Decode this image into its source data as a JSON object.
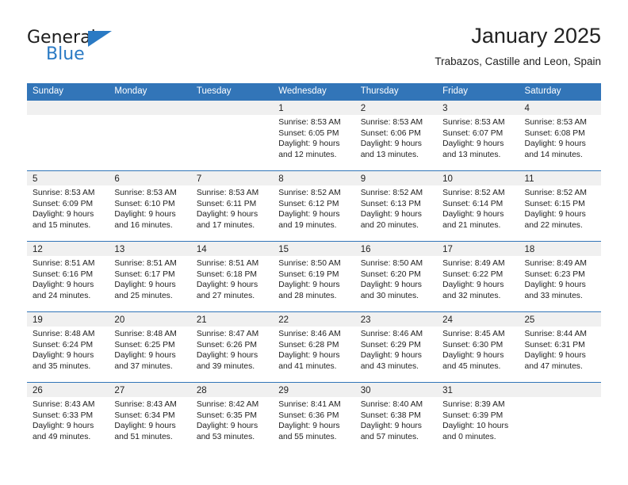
{
  "brand": {
    "name_part1": "General",
    "name_part2": "Blue",
    "triangle_icon": "triangle-icon",
    "accent_color": "#2a7ac4"
  },
  "header": {
    "title": "January 2025",
    "subtitle": "Trabazos, Castille and Leon, Spain"
  },
  "calendar": {
    "header_bg": "#3275b8",
    "daynum_bg": "#f0f0f0",
    "weekdays": [
      "Sunday",
      "Monday",
      "Tuesday",
      "Wednesday",
      "Thursday",
      "Friday",
      "Saturday"
    ],
    "weeks": [
      [
        {
          "day": "",
          "sunrise": "",
          "sunset": "",
          "daylight1": "",
          "daylight2": ""
        },
        {
          "day": "",
          "sunrise": "",
          "sunset": "",
          "daylight1": "",
          "daylight2": ""
        },
        {
          "day": "",
          "sunrise": "",
          "sunset": "",
          "daylight1": "",
          "daylight2": ""
        },
        {
          "day": "1",
          "sunrise": "Sunrise: 8:53 AM",
          "sunset": "Sunset: 6:05 PM",
          "daylight1": "Daylight: 9 hours",
          "daylight2": "and 12 minutes."
        },
        {
          "day": "2",
          "sunrise": "Sunrise: 8:53 AM",
          "sunset": "Sunset: 6:06 PM",
          "daylight1": "Daylight: 9 hours",
          "daylight2": "and 13 minutes."
        },
        {
          "day": "3",
          "sunrise": "Sunrise: 8:53 AM",
          "sunset": "Sunset: 6:07 PM",
          "daylight1": "Daylight: 9 hours",
          "daylight2": "and 13 minutes."
        },
        {
          "day": "4",
          "sunrise": "Sunrise: 8:53 AM",
          "sunset": "Sunset: 6:08 PM",
          "daylight1": "Daylight: 9 hours",
          "daylight2": "and 14 minutes."
        }
      ],
      [
        {
          "day": "5",
          "sunrise": "Sunrise: 8:53 AM",
          "sunset": "Sunset: 6:09 PM",
          "daylight1": "Daylight: 9 hours",
          "daylight2": "and 15 minutes."
        },
        {
          "day": "6",
          "sunrise": "Sunrise: 8:53 AM",
          "sunset": "Sunset: 6:10 PM",
          "daylight1": "Daylight: 9 hours",
          "daylight2": "and 16 minutes."
        },
        {
          "day": "7",
          "sunrise": "Sunrise: 8:53 AM",
          "sunset": "Sunset: 6:11 PM",
          "daylight1": "Daylight: 9 hours",
          "daylight2": "and 17 minutes."
        },
        {
          "day": "8",
          "sunrise": "Sunrise: 8:52 AM",
          "sunset": "Sunset: 6:12 PM",
          "daylight1": "Daylight: 9 hours",
          "daylight2": "and 19 minutes."
        },
        {
          "day": "9",
          "sunrise": "Sunrise: 8:52 AM",
          "sunset": "Sunset: 6:13 PM",
          "daylight1": "Daylight: 9 hours",
          "daylight2": "and 20 minutes."
        },
        {
          "day": "10",
          "sunrise": "Sunrise: 8:52 AM",
          "sunset": "Sunset: 6:14 PM",
          "daylight1": "Daylight: 9 hours",
          "daylight2": "and 21 minutes."
        },
        {
          "day": "11",
          "sunrise": "Sunrise: 8:52 AM",
          "sunset": "Sunset: 6:15 PM",
          "daylight1": "Daylight: 9 hours",
          "daylight2": "and 22 minutes."
        }
      ],
      [
        {
          "day": "12",
          "sunrise": "Sunrise: 8:51 AM",
          "sunset": "Sunset: 6:16 PM",
          "daylight1": "Daylight: 9 hours",
          "daylight2": "and 24 minutes."
        },
        {
          "day": "13",
          "sunrise": "Sunrise: 8:51 AM",
          "sunset": "Sunset: 6:17 PM",
          "daylight1": "Daylight: 9 hours",
          "daylight2": "and 25 minutes."
        },
        {
          "day": "14",
          "sunrise": "Sunrise: 8:51 AM",
          "sunset": "Sunset: 6:18 PM",
          "daylight1": "Daylight: 9 hours",
          "daylight2": "and 27 minutes."
        },
        {
          "day": "15",
          "sunrise": "Sunrise: 8:50 AM",
          "sunset": "Sunset: 6:19 PM",
          "daylight1": "Daylight: 9 hours",
          "daylight2": "and 28 minutes."
        },
        {
          "day": "16",
          "sunrise": "Sunrise: 8:50 AM",
          "sunset": "Sunset: 6:20 PM",
          "daylight1": "Daylight: 9 hours",
          "daylight2": "and 30 minutes."
        },
        {
          "day": "17",
          "sunrise": "Sunrise: 8:49 AM",
          "sunset": "Sunset: 6:22 PM",
          "daylight1": "Daylight: 9 hours",
          "daylight2": "and 32 minutes."
        },
        {
          "day": "18",
          "sunrise": "Sunrise: 8:49 AM",
          "sunset": "Sunset: 6:23 PM",
          "daylight1": "Daylight: 9 hours",
          "daylight2": "and 33 minutes."
        }
      ],
      [
        {
          "day": "19",
          "sunrise": "Sunrise: 8:48 AM",
          "sunset": "Sunset: 6:24 PM",
          "daylight1": "Daylight: 9 hours",
          "daylight2": "and 35 minutes."
        },
        {
          "day": "20",
          "sunrise": "Sunrise: 8:48 AM",
          "sunset": "Sunset: 6:25 PM",
          "daylight1": "Daylight: 9 hours",
          "daylight2": "and 37 minutes."
        },
        {
          "day": "21",
          "sunrise": "Sunrise: 8:47 AM",
          "sunset": "Sunset: 6:26 PM",
          "daylight1": "Daylight: 9 hours",
          "daylight2": "and 39 minutes."
        },
        {
          "day": "22",
          "sunrise": "Sunrise: 8:46 AM",
          "sunset": "Sunset: 6:28 PM",
          "daylight1": "Daylight: 9 hours",
          "daylight2": "and 41 minutes."
        },
        {
          "day": "23",
          "sunrise": "Sunrise: 8:46 AM",
          "sunset": "Sunset: 6:29 PM",
          "daylight1": "Daylight: 9 hours",
          "daylight2": "and 43 minutes."
        },
        {
          "day": "24",
          "sunrise": "Sunrise: 8:45 AM",
          "sunset": "Sunset: 6:30 PM",
          "daylight1": "Daylight: 9 hours",
          "daylight2": "and 45 minutes."
        },
        {
          "day": "25",
          "sunrise": "Sunrise: 8:44 AM",
          "sunset": "Sunset: 6:31 PM",
          "daylight1": "Daylight: 9 hours",
          "daylight2": "and 47 minutes."
        }
      ],
      [
        {
          "day": "26",
          "sunrise": "Sunrise: 8:43 AM",
          "sunset": "Sunset: 6:33 PM",
          "daylight1": "Daylight: 9 hours",
          "daylight2": "and 49 minutes."
        },
        {
          "day": "27",
          "sunrise": "Sunrise: 8:43 AM",
          "sunset": "Sunset: 6:34 PM",
          "daylight1": "Daylight: 9 hours",
          "daylight2": "and 51 minutes."
        },
        {
          "day": "28",
          "sunrise": "Sunrise: 8:42 AM",
          "sunset": "Sunset: 6:35 PM",
          "daylight1": "Daylight: 9 hours",
          "daylight2": "and 53 minutes."
        },
        {
          "day": "29",
          "sunrise": "Sunrise: 8:41 AM",
          "sunset": "Sunset: 6:36 PM",
          "daylight1": "Daylight: 9 hours",
          "daylight2": "and 55 minutes."
        },
        {
          "day": "30",
          "sunrise": "Sunrise: 8:40 AM",
          "sunset": "Sunset: 6:38 PM",
          "daylight1": "Daylight: 9 hours",
          "daylight2": "and 57 minutes."
        },
        {
          "day": "31",
          "sunrise": "Sunrise: 8:39 AM",
          "sunset": "Sunset: 6:39 PM",
          "daylight1": "Daylight: 10 hours",
          "daylight2": "and 0 minutes."
        },
        {
          "day": "",
          "sunrise": "",
          "sunset": "",
          "daylight1": "",
          "daylight2": ""
        }
      ]
    ]
  }
}
